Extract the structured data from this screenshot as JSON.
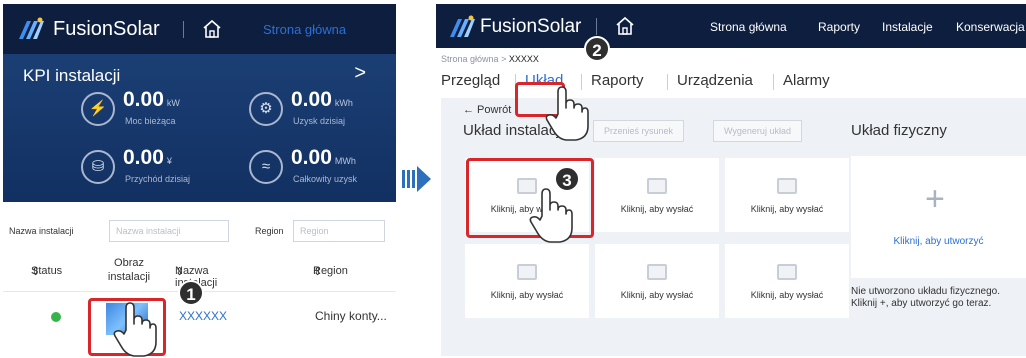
{
  "left": {
    "brand": "FusionSolar",
    "home_link": "Strona główna",
    "kpi": {
      "title": "KPI instalacji",
      "chevron": ">",
      "cells": [
        {
          "value": "0.00",
          "unit": "kW",
          "label": "Moc bieżąca",
          "icon": "⚡"
        },
        {
          "value": "0.00",
          "unit": "kWh",
          "label": "Uzysk dzisiaj",
          "icon": "⚙"
        },
        {
          "value": "0.00",
          "unit": "¥",
          "label": "Przychód dzisiaj",
          "icon": "⛁"
        },
        {
          "value": "0.00",
          "unit": "MWh",
          "label": "Całkowity uzysk",
          "icon": "≈"
        }
      ]
    },
    "filter": {
      "name_label": "Nazwa instalacji",
      "name_placeholder": "Nazwa instalacji",
      "region_label": "Region",
      "region_placeholder": "Region"
    },
    "table": {
      "headers": [
        "Status",
        "Obraz instalacji",
        "Nazwa instalacji",
        "Region"
      ],
      "row": {
        "status_color": "#36b44a",
        "name": "XXXXXX",
        "region": "Chiny konty..."
      }
    }
  },
  "right": {
    "brand": "FusionSolar",
    "nav": [
      "Strona główna",
      "Raporty",
      "Instalacje",
      "Konserwacja"
    ],
    "breadcrumb": {
      "root": "Strona główna",
      "sep": ">",
      "current": "XXXXX"
    },
    "tabs": [
      "Przegląd",
      "Układ",
      "Raporty",
      "Urządzenia",
      "Alarmy"
    ],
    "back": "← Powrót",
    "section_title": "Układ instalacji",
    "move_button": "Przenieś rysunek",
    "generate_button": "Wygeneruj układ",
    "physical_title": "Układ fizyczny",
    "upload_label": "Kliknij, aby wysłać",
    "physical_link": "Kliknij, aby utworzyć",
    "note_line1": "Nie utworzono układu fizycznego.",
    "note_line2": "Kliknij +, aby utworzyć go teraz."
  },
  "steps": [
    "1",
    "2",
    "3"
  ],
  "colors": {
    "header_bg": "#0e1e3e",
    "kpi_bg": "#1b3f74",
    "accent": "#2b6fd6",
    "highlight": "#d8262b",
    "status_ok": "#36b44a"
  }
}
